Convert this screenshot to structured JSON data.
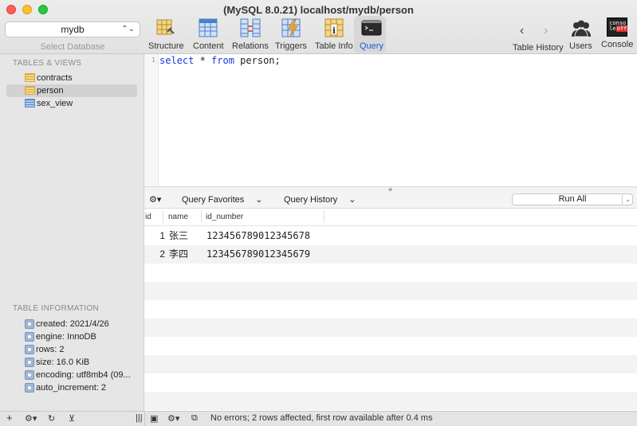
{
  "window": {
    "title": "(MySQL 8.0.21) localhost/mydb/person"
  },
  "database_select": {
    "value": "mydb",
    "caption": "Select Database"
  },
  "toolbar": {
    "structure": "Structure",
    "content": "Content",
    "relations": "Relations",
    "triggers": "Triggers",
    "table_info": "Table Info",
    "query": "Query",
    "table_history": "Table History",
    "users": "Users",
    "console": "Console",
    "console_icon_text_1": "conso",
    "console_icon_text_2": "le",
    "console_icon_text_3": "off"
  },
  "sidebar": {
    "tables_header": "TABLES & VIEWS",
    "tables": [
      {
        "name": "contracts",
        "kind": "table"
      },
      {
        "name": "person",
        "kind": "table",
        "selected": true
      },
      {
        "name": "sex_view",
        "kind": "view"
      }
    ],
    "info_header": "TABLE INFORMATION",
    "info": [
      "created: 2021/4/26",
      "engine: InnoDB",
      "rows: 2",
      "size: 16.0 KiB",
      "encoding: utf8mb4 (09...",
      "auto_increment: 2"
    ]
  },
  "editor": {
    "line_number": "1",
    "kw_select": "select",
    "star": " * ",
    "kw_from": "from",
    "rest": " person;"
  },
  "query_bar": {
    "favorites": "Query Favorites",
    "history": "Query History",
    "run_all": "Run All"
  },
  "results": {
    "columns": [
      "id",
      "name",
      "id_number"
    ],
    "rows": [
      {
        "id": "1",
        "name": "张三",
        "id_number": "123456789012345678"
      },
      {
        "id": "2",
        "name": "李四",
        "id_number": "123456789012345679"
      }
    ]
  },
  "status": {
    "message": "No errors; 2 rows affected, first row available after 0.4 ms"
  }
}
